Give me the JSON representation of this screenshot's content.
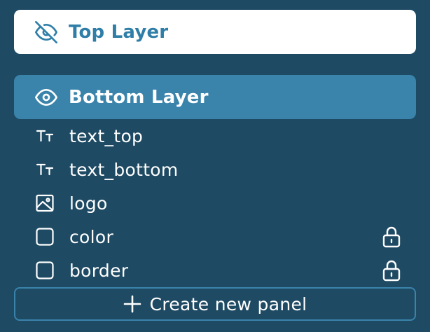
{
  "layers": {
    "top": {
      "label": "Top Layer",
      "icon": "eye-off-icon",
      "color": "#2f7ea8"
    },
    "bottom": {
      "label": "Bottom Layer",
      "icon": "eye-icon",
      "color": "#3a83ab"
    }
  },
  "panels": [
    {
      "label": "text_top",
      "icon": "text-icon",
      "locked": false
    },
    {
      "label": "text_bottom",
      "icon": "text-icon",
      "locked": false
    },
    {
      "label": "logo",
      "icon": "image-icon",
      "locked": false
    },
    {
      "label": "color",
      "icon": "square-icon",
      "locked": true
    },
    {
      "label": "border",
      "icon": "square-icon",
      "locked": true
    }
  ],
  "create_button": {
    "label": "Create new panel",
    "icon": "plus-icon"
  },
  "colors": {
    "background": "#1e4a63",
    "accent": "#3a83ab",
    "text": "#ffffff"
  }
}
